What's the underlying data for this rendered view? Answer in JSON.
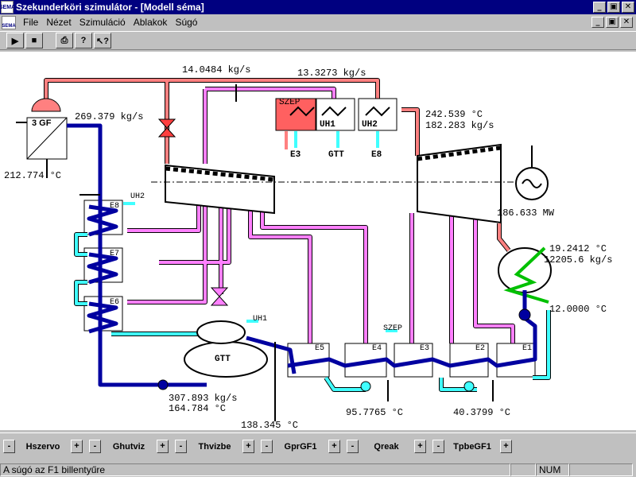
{
  "window": {
    "title": "Szekunderköri szimulátor - [Modell séma]",
    "app_icon": "SEMA",
    "controls": {
      "minimize": "_",
      "maximize": "▣",
      "close": "✕"
    }
  },
  "menu": {
    "items": [
      "File",
      "Nézet",
      "Szimuláció",
      "Ablakok",
      "Súgó"
    ],
    "mdi_controls": {
      "minimize": "_",
      "restore": "▣",
      "close": "✕"
    }
  },
  "toolbar": {
    "play": "▶",
    "stop": "■",
    "print": "⎙",
    "help": "?",
    "context_help": "↖?"
  },
  "diagram": {
    "components": {
      "gf": "3 GF",
      "szep": "SZEP",
      "uh1": "UH1",
      "uh2": "UH2",
      "e3_out": "E3",
      "gtt_out": "GTT",
      "e8_out": "E8",
      "gtt": "GTT",
      "e8": "E8",
      "e7": "E7",
      "e6": "E6",
      "e5": "E5",
      "e4": "E4",
      "e3": "E3",
      "e2": "E2",
      "e1": "E1",
      "uh2_side": "UH2",
      "uh1_side": "UH1",
      "szep_side": "SZEP"
    },
    "readings": {
      "flow_top_1": "14.0484 kg/s",
      "flow_top_2": "13.3273 kg/s",
      "flow_gf": "269.379 kg/s",
      "temp_hp_out": "242.539 °C",
      "flow_hp_out": "182.283 kg/s",
      "temp_feed": "212.774 °C",
      "power": "186.633 MW",
      "temp_cond_1": "19.2412 °C",
      "flow_cond": "12205.6 kg/s",
      "temp_cond_2": "12.0000 °C",
      "flow_feed_pump": "307.893 kg/s",
      "temp_feed_pump": "164.784 °C",
      "temp_bottom_1": "138.345 °C",
      "temp_bottom_2": "95.7765 °C",
      "temp_bottom_3": "40.3799 °C"
    }
  },
  "controls": [
    {
      "label": "Hszervo",
      "minus": "-",
      "plus": "+"
    },
    {
      "label": "Ghutviz",
      "minus": "-",
      "plus": "+"
    },
    {
      "label": "Thvizbe",
      "minus": "-",
      "plus": "+"
    },
    {
      "label": "GprGF1",
      "minus": "-",
      "plus": "+"
    },
    {
      "label": "Qreak",
      "minus": "-",
      "plus": "+"
    },
    {
      "label": "TpbeGF1",
      "minus": "-",
      "plus": "+"
    }
  ],
  "status": {
    "message": "A súgó az F1 billentyűre",
    "num": "NUM"
  },
  "colors": {
    "live_steam": "#ff8080",
    "extraction": "#ff80ff",
    "feedwater": "#0000a0",
    "cooling": "#40ffff",
    "condenser_coil": "#00c000",
    "szep_fill": "#ff6060",
    "valve": "#ff4040"
  }
}
